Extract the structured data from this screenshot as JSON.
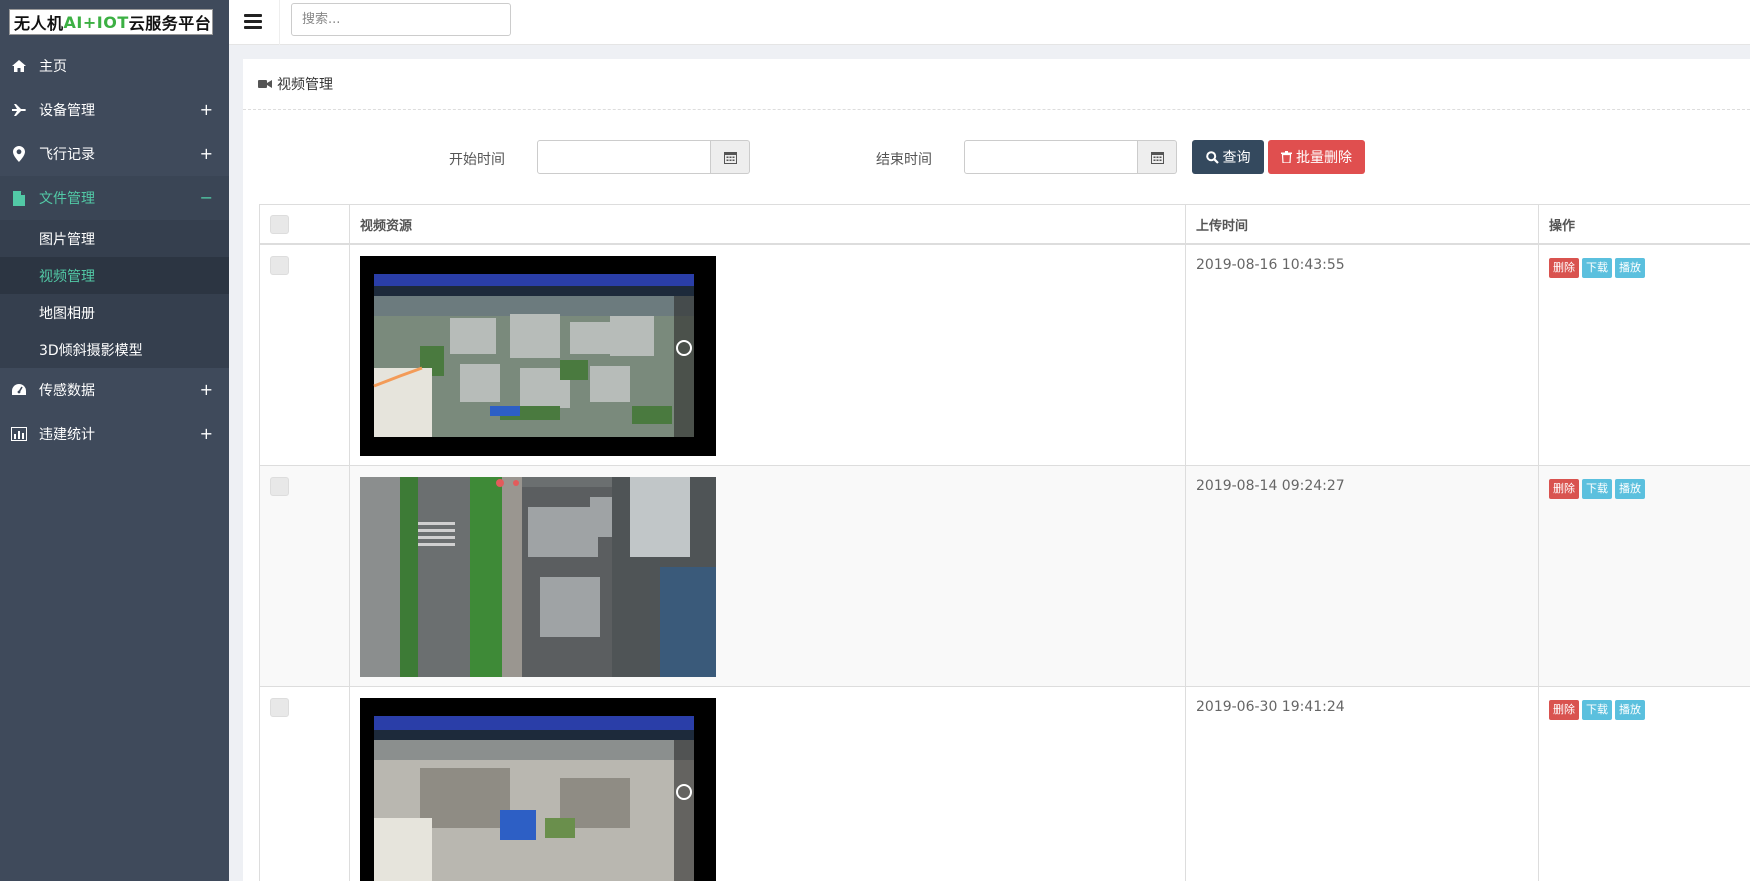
{
  "app": {
    "logo_prefix": "无人机",
    "logo_green": "AI+IOT",
    "logo_suffix": "云服务平台"
  },
  "sidebar": {
    "items": [
      {
        "label": "主页",
        "icon": "home-icon",
        "toggle": ""
      },
      {
        "label": "设备管理",
        "icon": "plane-icon",
        "toggle": "+"
      },
      {
        "label": "飞行记录",
        "icon": "map-marker-icon",
        "toggle": "+"
      },
      {
        "label": "文件管理",
        "icon": "file-icon",
        "toggle": "−"
      },
      {
        "label": "传感数据",
        "icon": "dashboard-icon",
        "toggle": "+"
      },
      {
        "label": "违建统计",
        "icon": "bar-chart-icon",
        "toggle": "+"
      }
    ],
    "sub_items": [
      {
        "label": "图片管理"
      },
      {
        "label": "视频管理"
      },
      {
        "label": "地图相册"
      },
      {
        "label": "3D倾斜摄影模型"
      }
    ]
  },
  "header": {
    "search_placeholder": "搜索..."
  },
  "panel": {
    "title": "视频管理",
    "start_label": "开始时间",
    "end_label": "结束时间",
    "start_value": "",
    "end_value": "",
    "query_label": "查询",
    "batch_delete_label": "批量删除"
  },
  "table": {
    "columns": [
      "",
      "视频资源",
      "上传时间",
      "操作"
    ],
    "rows": [
      {
        "upload_time": "2019-08-16 10:43:55",
        "thumb": "drone-hud-video-thumbnail"
      },
      {
        "upload_time": "2019-08-14 09:24:27",
        "thumb": "aerial-street-video-thumbnail"
      },
      {
        "upload_time": "2019-06-30 19:41:24",
        "thumb": "drone-hud-video-thumbnail"
      }
    ],
    "op_delete": "删除",
    "op_download": "下载",
    "op_play": "播放"
  },
  "colors": {
    "sidebar_bg": "#3f4a5b",
    "accent_green": "#52c9a6",
    "query_btn": "#34495e",
    "danger": "#e04f4f",
    "info": "#5bc0de"
  }
}
